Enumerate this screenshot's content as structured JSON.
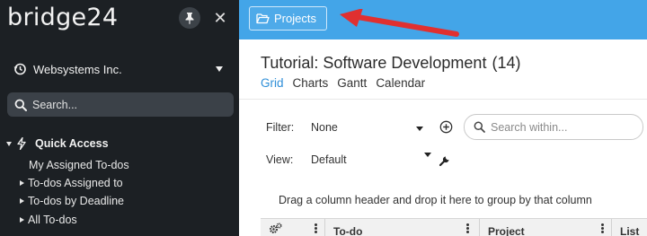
{
  "app": {
    "brand": "bridge24",
    "pin_icon": "pin-icon",
    "close_icon": "close-icon",
    "close_glyph": "✕"
  },
  "sidebar": {
    "workspace": "Websystems Inc.",
    "search_placeholder": "Search...",
    "quick_access_label": "Quick Access",
    "items": [
      {
        "label": "My Assigned To-dos",
        "expandable": false
      },
      {
        "label": "To-dos Assigned to",
        "expandable": true
      },
      {
        "label": "To-dos by Deadline",
        "expandable": true
      },
      {
        "label": "All To-dos",
        "expandable": true
      }
    ]
  },
  "topbar": {
    "projects_label": "Projects",
    "accent_color": "#43a5e8",
    "annotation_color": "#e03030"
  },
  "main": {
    "project_title": "Tutorial: Software Development",
    "project_count": "(14)",
    "tabs": [
      {
        "label": "Grid",
        "active": true
      },
      {
        "label": "Charts",
        "active": false
      },
      {
        "label": "Gantt",
        "active": false
      },
      {
        "label": "Calendar",
        "active": false
      }
    ],
    "filter_label": "Filter:",
    "filter_value": "None",
    "view_label": "View:",
    "view_value": "Default",
    "search_placeholder": "Search within...",
    "group_hint": "Drag a column header and drop it here to group by that column",
    "columns": [
      "To-do",
      "Project",
      "List"
    ]
  }
}
